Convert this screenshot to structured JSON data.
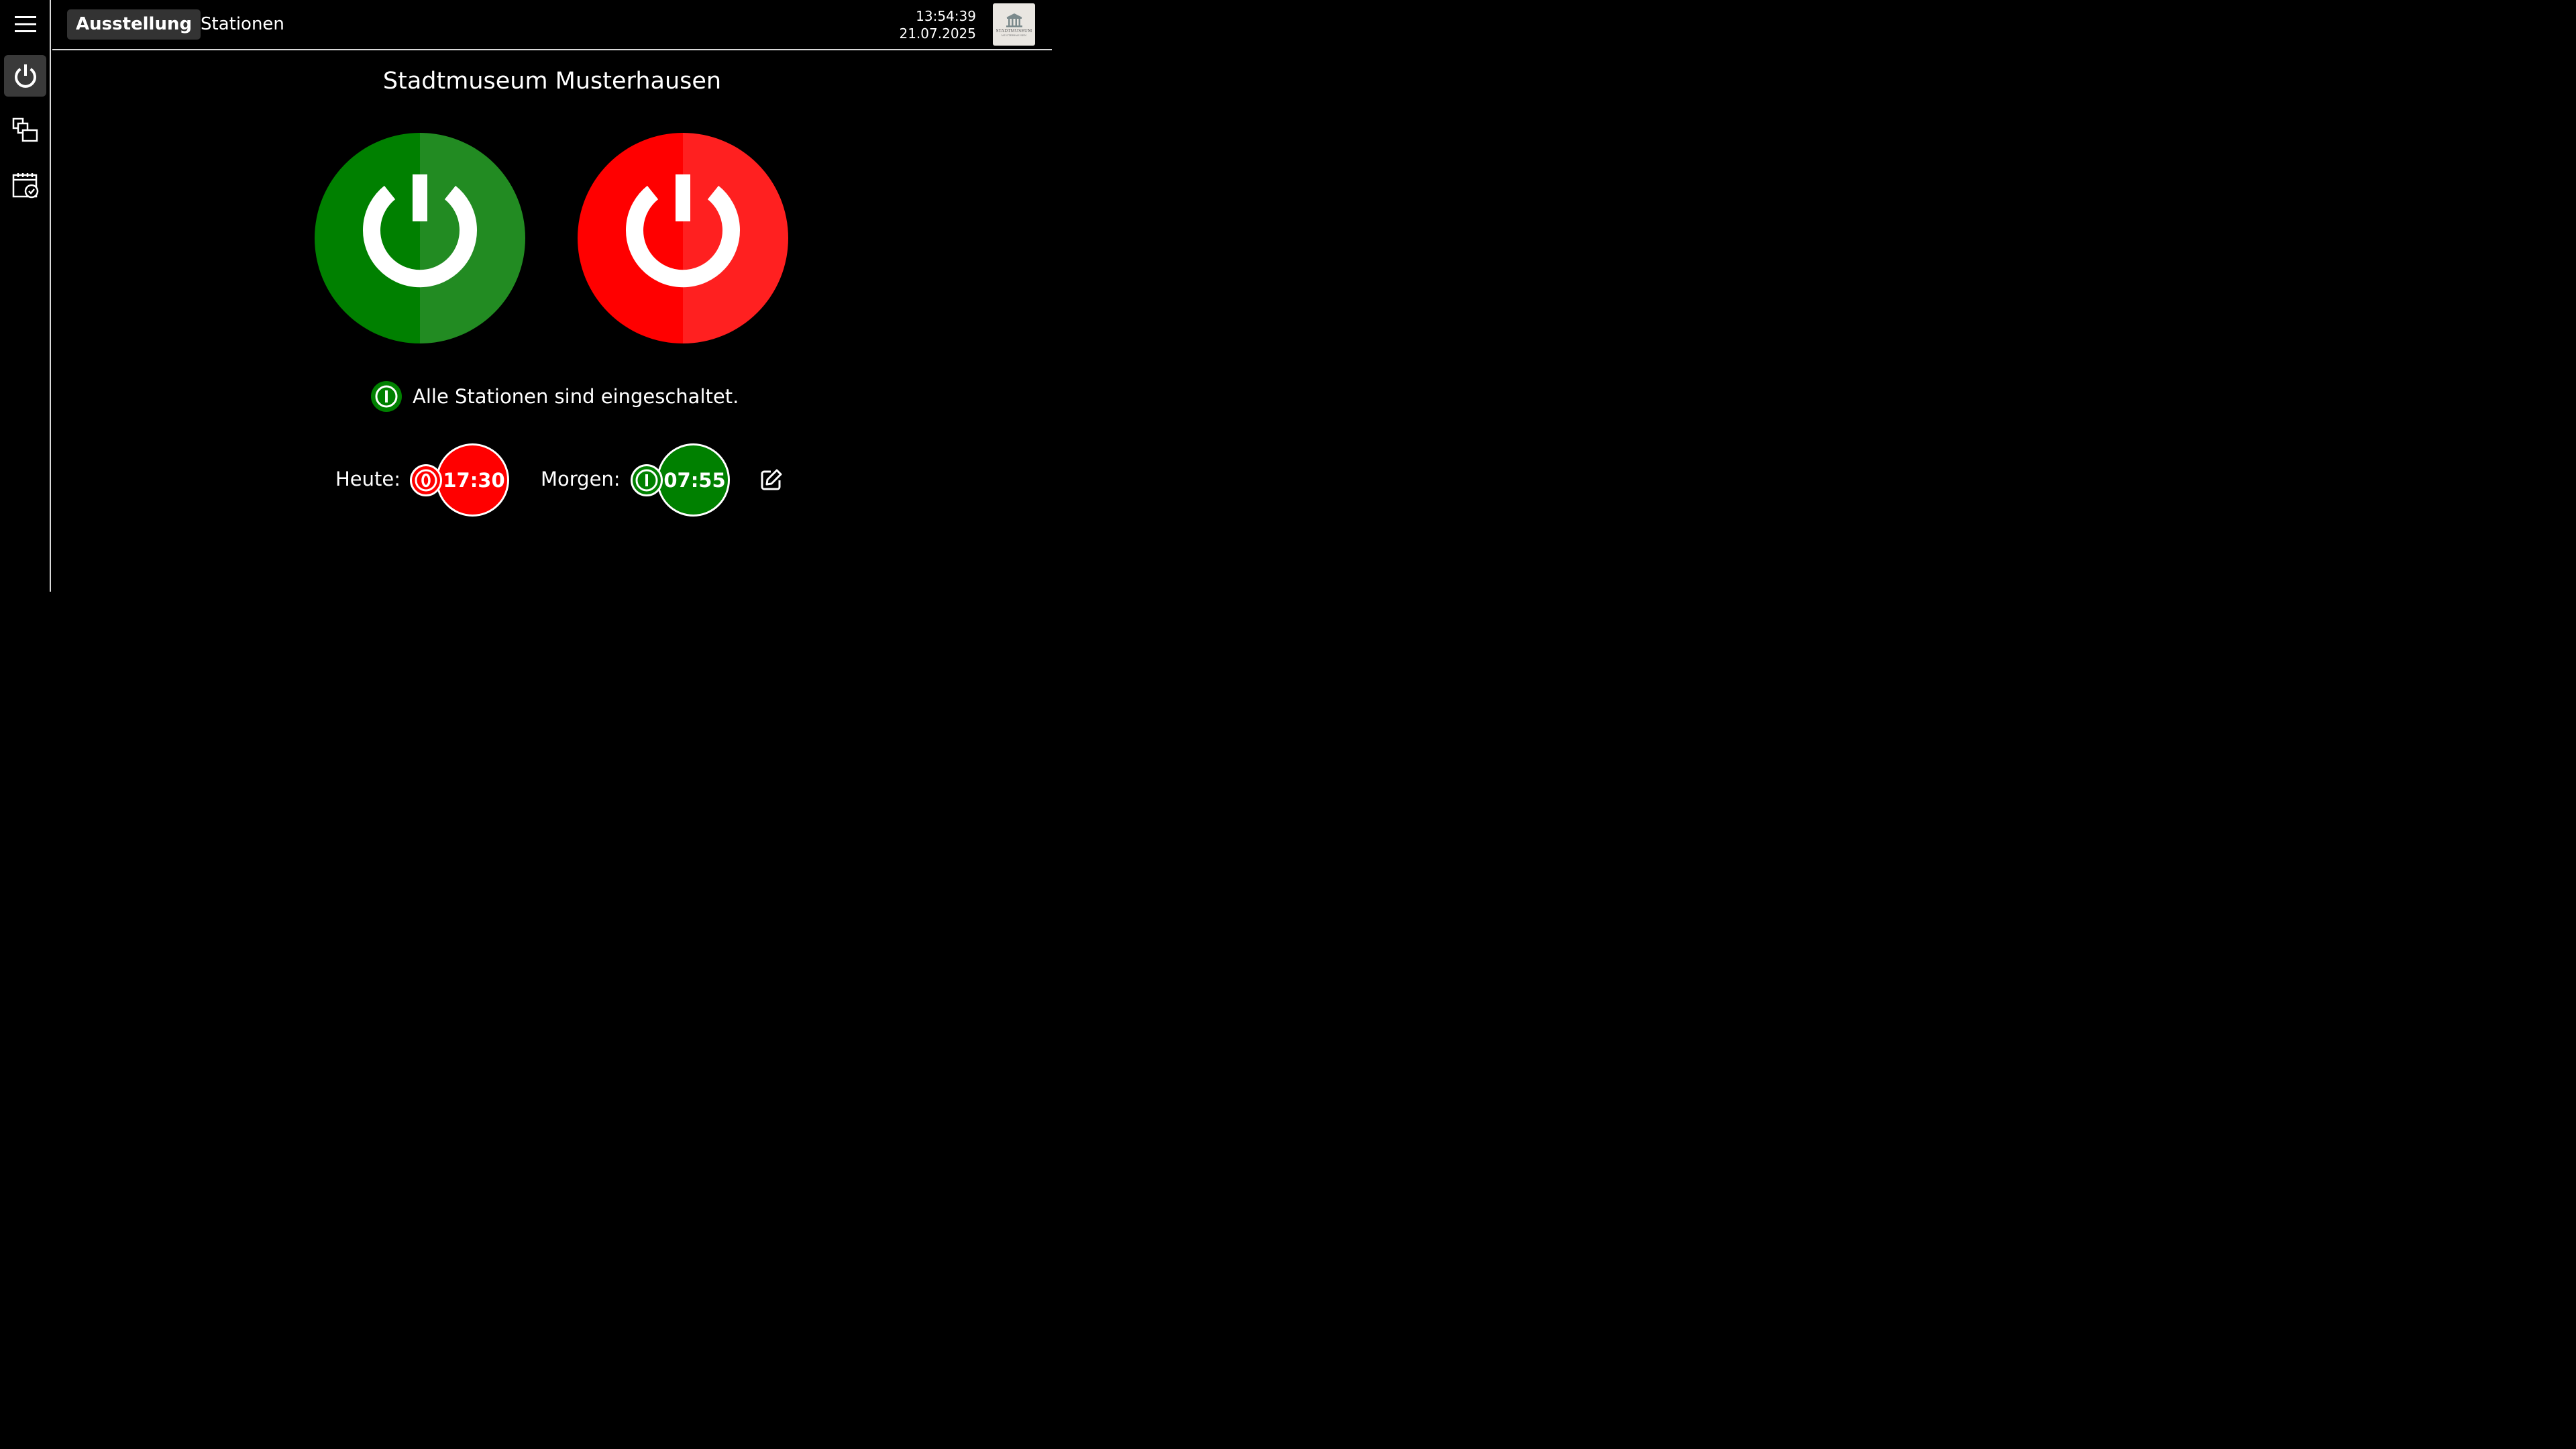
{
  "tabs": [
    {
      "label": "Ausstellung",
      "active": true
    },
    {
      "label": "Stationen",
      "active": false
    }
  ],
  "clock": {
    "time": "13:54:39",
    "date": "21.07.2025"
  },
  "logo": {
    "line1": "STADTMUSEUM",
    "line2": "MUSTERHAUSEN"
  },
  "sidebar": {
    "items": [
      {
        "icon": "power-icon",
        "active": true
      },
      {
        "icon": "stations-icon",
        "active": false
      },
      {
        "icon": "calendar-clock-icon",
        "active": false
      }
    ]
  },
  "main": {
    "title": "Stadtmuseum Musterhausen",
    "power_on": {
      "icon": "power-icon",
      "color": "#008000"
    },
    "power_off": {
      "icon": "power-icon",
      "color": "#ff0000"
    },
    "status": {
      "text": "Alle Stationen sind eingeschaltet.",
      "icon": "on-icon",
      "color": "#008000"
    }
  },
  "schedule": {
    "today": {
      "label": "Heute:",
      "action_icon": "off-icon",
      "time": "17:30",
      "color": "#ff0000"
    },
    "tomorrow": {
      "label": "Morgen:",
      "action_icon": "on-icon",
      "time": "07:55",
      "color": "#008000"
    },
    "edit_icon": "edit-icon"
  }
}
